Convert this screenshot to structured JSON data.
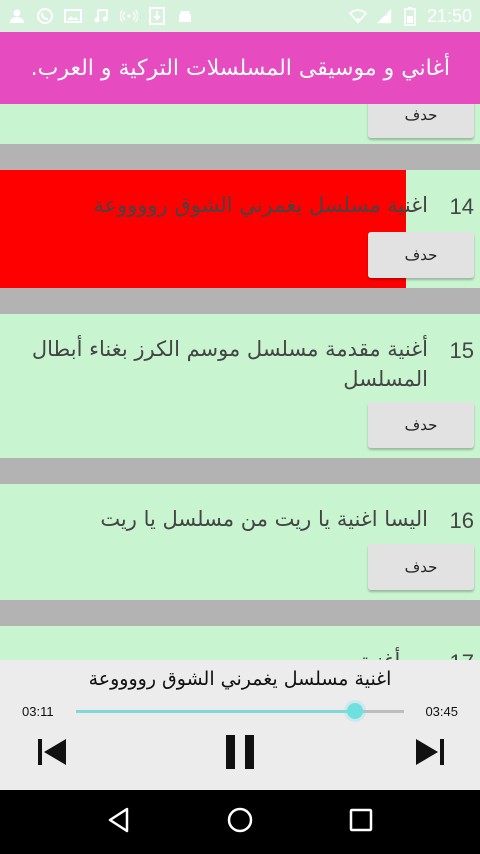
{
  "status": {
    "time": "21:50",
    "signal_label": "3G"
  },
  "app": {
    "title": "أغاني و موسيقى المسلسلات التركية و العرب."
  },
  "list": {
    "delete_label": "حدف",
    "items": [
      {
        "num": "14",
        "title": "اغنية مسلسل يغمرني الشوق رووووعة",
        "playing": true
      },
      {
        "num": "15",
        "title": "أغنية مقدمة مسلسل موسم الكرز بغناء أبطال المسلسل"
      },
      {
        "num": "16",
        "title": "اليسا اغنية يا ريت من مسلسل يا ريت"
      },
      {
        "num": "17",
        "title": "… أغنية …"
      }
    ]
  },
  "player": {
    "title": "اغنية مسلسل يغمرني الشوق رووووعة",
    "current_time": "03:11",
    "total_time": "03:45",
    "progress": 0.85
  },
  "colors": {
    "appbar": "#e64bc0",
    "playing": "#ff0000",
    "list_bg": "#c8f5d0",
    "separator": "#b3b3b3",
    "seek": "#6fe0e0"
  }
}
